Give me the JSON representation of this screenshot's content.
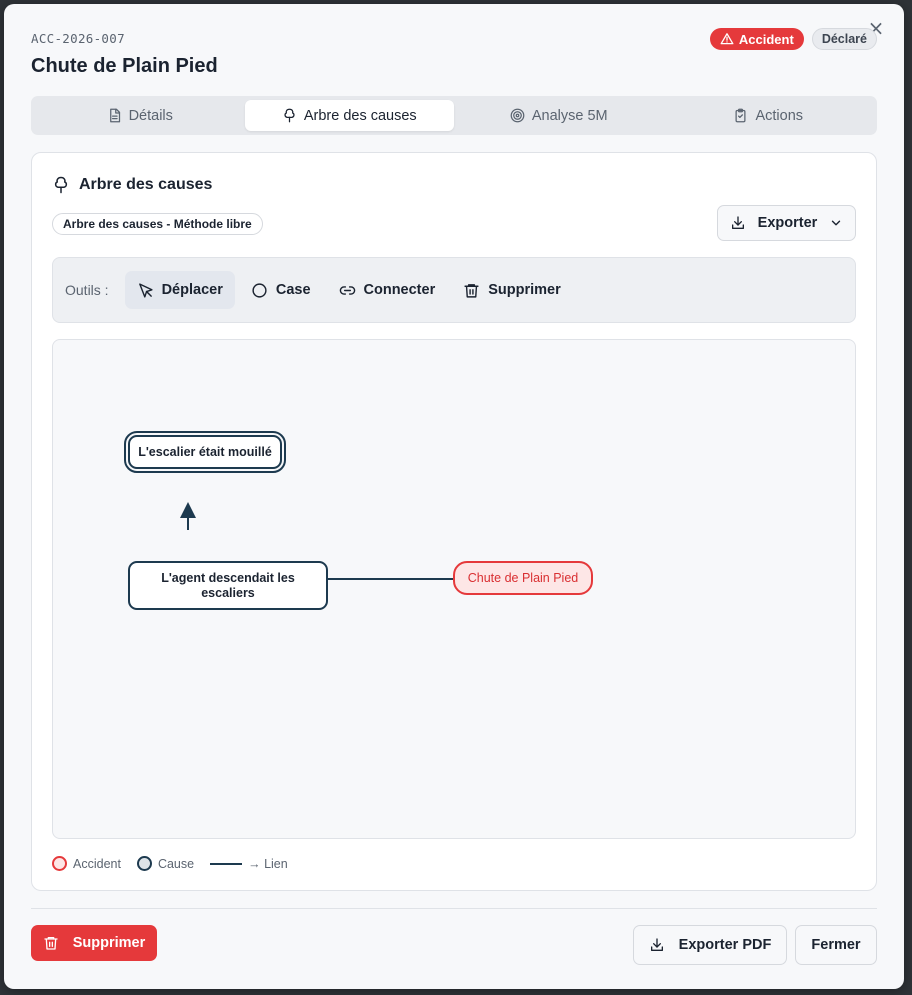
{
  "header": {
    "reference": "ACC-2026-007",
    "title": "Chute de Plain Pied",
    "type_badge": "Accident",
    "status_badge": "Déclaré",
    "close_symbol": "×"
  },
  "tabs": [
    {
      "label": "Détails",
      "icon": "document-icon",
      "active": false
    },
    {
      "label": "Arbre des causes",
      "icon": "tree-icon",
      "active": true
    },
    {
      "label": "Analyse 5M",
      "icon": "target-icon",
      "active": false
    },
    {
      "label": "Actions",
      "icon": "clipboard-check-icon",
      "active": false
    }
  ],
  "panel": {
    "title": "Arbre des causes",
    "method": "Arbre des causes - Méthode libre",
    "export_label": "Exporter"
  },
  "toolbar": {
    "label": "Outils :",
    "tools": [
      {
        "label": "Déplacer",
        "icon": "cursor-arrow-icon",
        "active": true
      },
      {
        "label": "Case",
        "icon": "circle-icon",
        "active": false
      },
      {
        "label": "Connecter",
        "icon": "link-icon",
        "active": false
      },
      {
        "label": "Supprimer",
        "icon": "trash-icon",
        "active": false
      }
    ]
  },
  "diagram": {
    "nodes": [
      {
        "id": "n1",
        "text": "L'escalier était mouillé",
        "kind": "cause",
        "selected": true
      },
      {
        "id": "n2",
        "text": "L'agent descendait les escaliers",
        "kind": "cause",
        "selected": false
      },
      {
        "id": "n3",
        "text": "Chute de Plain Pied",
        "kind": "accident",
        "selected": false
      }
    ],
    "edges": [
      {
        "from": "n2",
        "to": "n1",
        "arrow": true
      },
      {
        "from": "n2",
        "to": "n3",
        "arrow": false
      }
    ]
  },
  "legend": {
    "accident": "Accident",
    "cause": "Cause",
    "link": "→ Lien"
  },
  "footer": {
    "delete_label": "Supprimer",
    "export_pdf_label": "Exporter PDF",
    "close_label": "Fermer"
  },
  "colors": {
    "accent_red": "#e5393b",
    "cause_border": "#1d3a4f",
    "accident_fill": "#fde6e6"
  }
}
